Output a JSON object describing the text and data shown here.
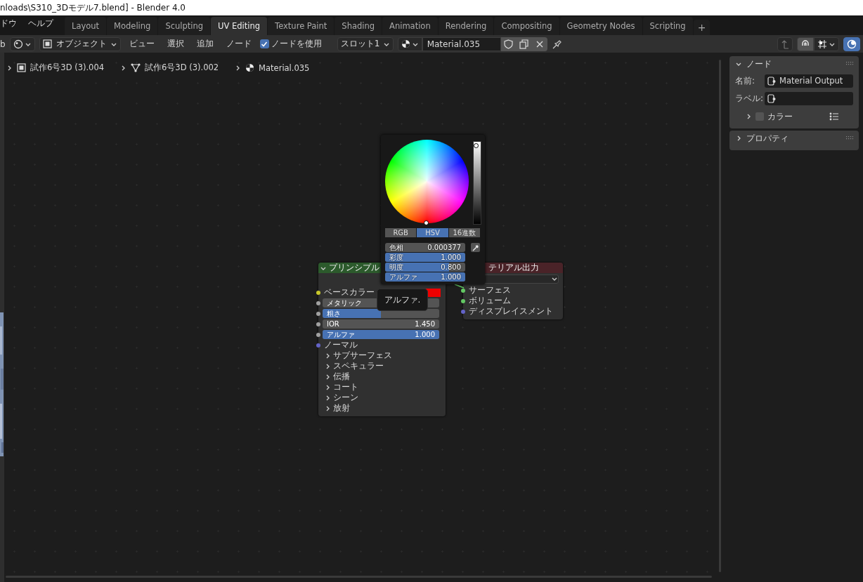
{
  "window": {
    "title": "nloads\\S310_3Dモデル7.blend] - Blender 4.0"
  },
  "menu": [
    "ドウ",
    "ヘルプ"
  ],
  "workspaces": [
    {
      "label": "Layout",
      "selected": false
    },
    {
      "label": "Modeling",
      "selected": false
    },
    {
      "label": "Sculpting",
      "selected": false
    },
    {
      "label": "UV Editing",
      "selected": true
    },
    {
      "label": "Texture Paint",
      "selected": false
    },
    {
      "label": "Shading",
      "selected": false
    },
    {
      "label": "Animation",
      "selected": false
    },
    {
      "label": "Rendering",
      "selected": false
    },
    {
      "label": "Compositing",
      "selected": false
    },
    {
      "label": "Geometry Nodes",
      "selected": false
    },
    {
      "label": "Scripting",
      "selected": false
    }
  ],
  "add_workspace": "+",
  "header": {
    "cut_label": "b",
    "mode": "オブジェクト",
    "menus": [
      "ビュー",
      "選択",
      "追加",
      "ノード"
    ],
    "use_nodes": {
      "label": "ノードを使用",
      "checked": true
    },
    "slot": "スロット1",
    "material": "Material.035"
  },
  "breadcrumbs": [
    {
      "kind": "object",
      "label": "試作6号3D (3).004"
    },
    {
      "kind": "mesh",
      "label": "試作6号3D (3).002"
    },
    {
      "kind": "material",
      "label": "Material.035"
    }
  ],
  "principled_node": {
    "title": "プリンシプル",
    "inputs": [
      {
        "kind": "color",
        "label": "ベースカラー",
        "color": "#ee0000"
      },
      {
        "kind": "slider",
        "label": "メタリック",
        "level": 0
      },
      {
        "kind": "slider",
        "label": "粗さ",
        "level": 0.5
      },
      {
        "kind": "number",
        "label": "IOR",
        "value": "1.450"
      },
      {
        "kind": "slider",
        "label": "アルファ",
        "value": "1.000",
        "level": 1
      },
      {
        "kind": "vector",
        "label": "ノーマル"
      }
    ],
    "panels": [
      "サブサーフェス",
      "スペキュラー",
      "伝播",
      "コート",
      "シーン",
      "放射"
    ]
  },
  "output_node": {
    "title": "テリアル出力",
    "inputs": [
      {
        "kind": "shader",
        "label": "サーフェス"
      },
      {
        "kind": "shader",
        "label": "ボリューム"
      },
      {
        "kind": "vector",
        "label": "ディスプレイスメント"
      }
    ]
  },
  "color_picker": {
    "brightness": {
      "level": 0.95
    },
    "modes": [
      {
        "label": "RGB",
        "selected": false
      },
      {
        "label": "HSV",
        "selected": true
      },
      {
        "label": "16進数",
        "selected": false
      }
    ],
    "fields": [
      {
        "label": "色相",
        "value": "0.000377",
        "level": 0.000377
      },
      {
        "label": "彩度",
        "value": "1.000",
        "level": 1
      },
      {
        "label": "明度",
        "value": "0.800",
        "level": 0.8
      },
      {
        "label": "アルファ",
        "value": "1.000",
        "level": 1
      }
    ]
  },
  "tooltip": "アルファ.",
  "sidebar": {
    "panels": [
      {
        "title": "ノード",
        "expanded": true,
        "fields": [
          {
            "label": "名前:",
            "value": "Material Output"
          },
          {
            "label": "ラベル:"
          }
        ],
        "subpanel": {
          "label": "カラー",
          "expanded": false,
          "checked": false
        }
      },
      {
        "title": "プロパティ",
        "expanded": false
      }
    ]
  }
}
